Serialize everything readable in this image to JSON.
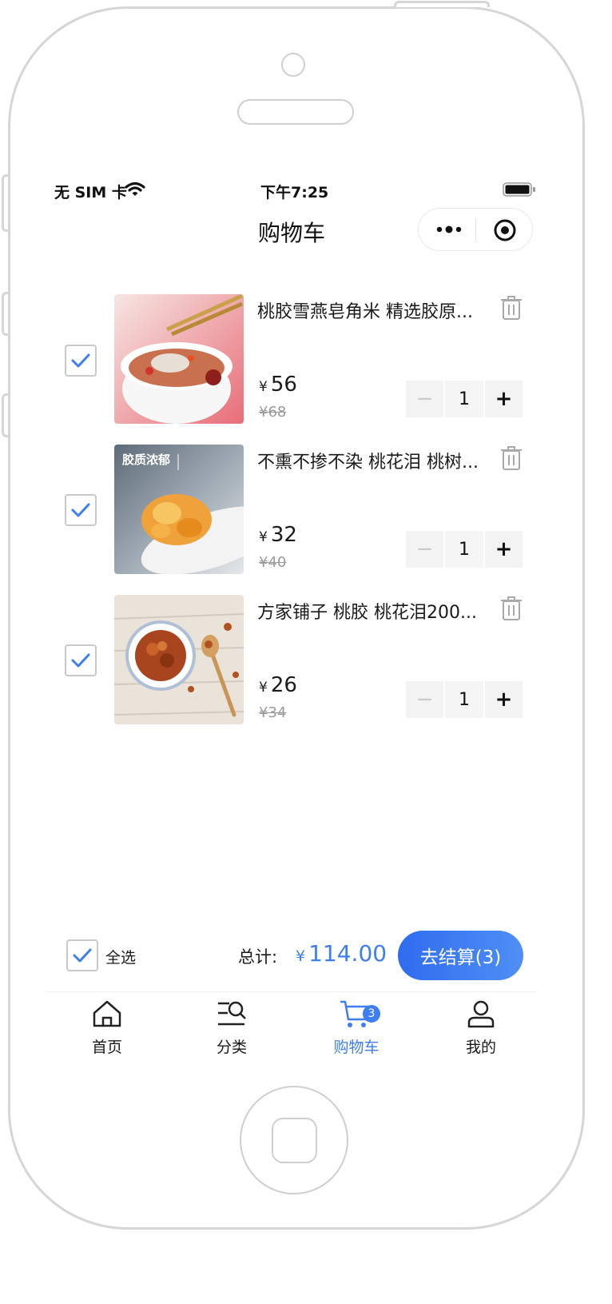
{
  "status_bar": {
    "carrier": "无 SIM 卡",
    "time": "下午7:25"
  },
  "header": {
    "title": "购物车"
  },
  "cart": {
    "items": [
      {
        "name": "桃胶雪燕皂角米 精选胶原...",
        "price_symbol": "¥",
        "price": "56",
        "original_price": "¥68",
        "quantity": "1",
        "checked": true,
        "image_text": ""
      },
      {
        "name": "不熏不掺不染 桃花泪 桃树...",
        "price_symbol": "¥",
        "price": "32",
        "original_price": "¥40",
        "quantity": "1",
        "checked": true,
        "image_text": "胶质浓郁"
      },
      {
        "name": "方家铺子 桃胶 桃花泪200...",
        "price_symbol": "¥",
        "price": "26",
        "original_price": "¥34",
        "quantity": "1",
        "checked": true,
        "image_text": ""
      }
    ],
    "stepper": {
      "minus": "−",
      "plus": "+"
    }
  },
  "summary": {
    "select_all_label": "全选",
    "total_label": "总计:",
    "total_symbol": "¥",
    "total_amount": "114.00",
    "checkout_label": "去结算(3)"
  },
  "tabbar": {
    "items": [
      {
        "label": "首页",
        "icon": "home-icon"
      },
      {
        "label": "分类",
        "icon": "category-icon"
      },
      {
        "label": "购物车",
        "icon": "cart-icon",
        "badge": "3",
        "active": true
      },
      {
        "label": "我的",
        "icon": "user-icon"
      }
    ]
  },
  "colors": {
    "accent": "#3d7ef0",
    "checkout_start": "#2f6cf0",
    "checkout_end": "#4f8ff5"
  }
}
